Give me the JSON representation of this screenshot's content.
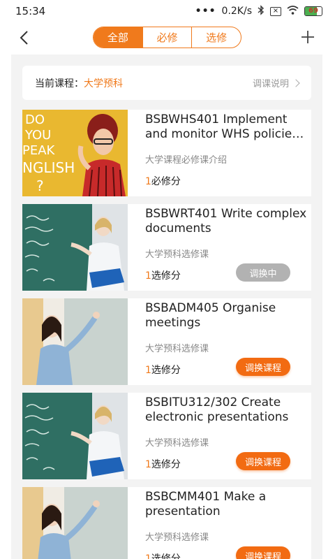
{
  "status": {
    "time": "15:34",
    "dots": "•••",
    "speed": "0.2K/s",
    "battery": "69"
  },
  "nav": {
    "tabs": [
      "全部",
      "必修",
      "选修"
    ],
    "active_index": 0
  },
  "current": {
    "label": "当前课程：",
    "value": "大学预科",
    "link": "调课说明"
  },
  "courses": [
    {
      "title": "BSBWHS401 Implement and monitor WHS policies, p...",
      "subtitle": "大学课程必修课介绍",
      "credit_num": "1",
      "credit_text": "必修分",
      "button": "",
      "button_style": "none",
      "thumb": "english-poster"
    },
    {
      "title": "BSBWRT401 Write complex documents",
      "subtitle": "大学预科选修课",
      "credit_num": "1",
      "credit_text": "选修分",
      "button": "调换中",
      "button_style": "grey",
      "thumb": "teacher-chalkboard-green"
    },
    {
      "title": "BSBADM405 Organise meetings",
      "subtitle": "大学预科选修课",
      "credit_num": "1",
      "credit_text": "选修分",
      "button": "调换课程",
      "button_style": "orange",
      "thumb": "teacher-whiteboard"
    },
    {
      "title": "BSBITU312/302 Create electronic presentations",
      "subtitle": "大学预科选修课",
      "credit_num": "1",
      "credit_text": "选修分",
      "button": "调换课程",
      "button_style": "orange",
      "thumb": "teacher-chalkboard-green"
    },
    {
      "title": "BSBCMM401 Make a presentation",
      "subtitle": "大学预科选修课",
      "credit_num": "1",
      "credit_text": "选修分",
      "button": "调换课程",
      "button_style": "orange",
      "thumb": "teacher-whiteboard"
    }
  ],
  "colors": {
    "accent": "#f07a1c",
    "button_orange": "#f26b12",
    "button_grey": "#b2b2b2",
    "background": "#f3f3f3"
  }
}
